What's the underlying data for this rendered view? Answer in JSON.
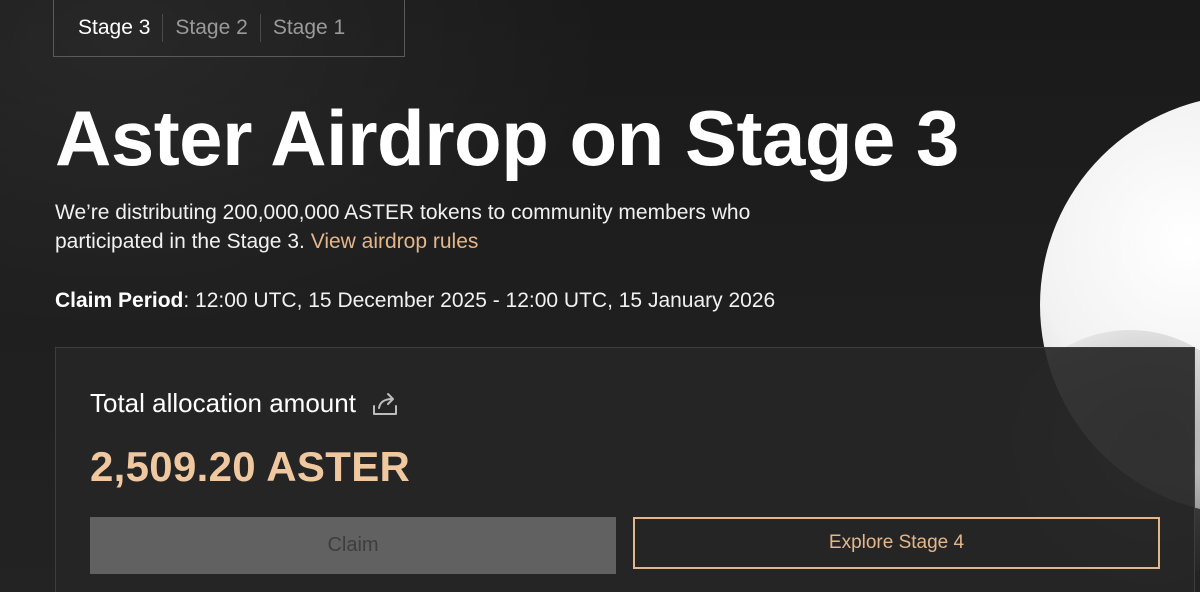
{
  "tabs": [
    {
      "label": "Stage 3",
      "active": true
    },
    {
      "label": "Stage 2",
      "active": false
    },
    {
      "label": "Stage 1",
      "active": false
    }
  ],
  "hero": {
    "title": "Aster Airdrop on Stage 3",
    "description": "We’re distributing 200,000,000 ASTER tokens to community members who participated in the Stage 3.",
    "rules_link": "View airdrop rules",
    "claim_period_label": "Claim Period",
    "claim_period_value": ": 12:00 UTC, 15 December 2025 - 12:00 UTC, 15 January 2026"
  },
  "allocation": {
    "label": "Total allocation amount",
    "share_icon": "share-icon",
    "amount": "2,509.20 ASTER"
  },
  "actions": {
    "claim_label": "Claim",
    "explore_label": "Explore Stage 4"
  },
  "colors": {
    "accent": "#e3b68b",
    "amount": "#efc8a0",
    "background": "#1b1b1b",
    "disabled_button": "#616161"
  }
}
